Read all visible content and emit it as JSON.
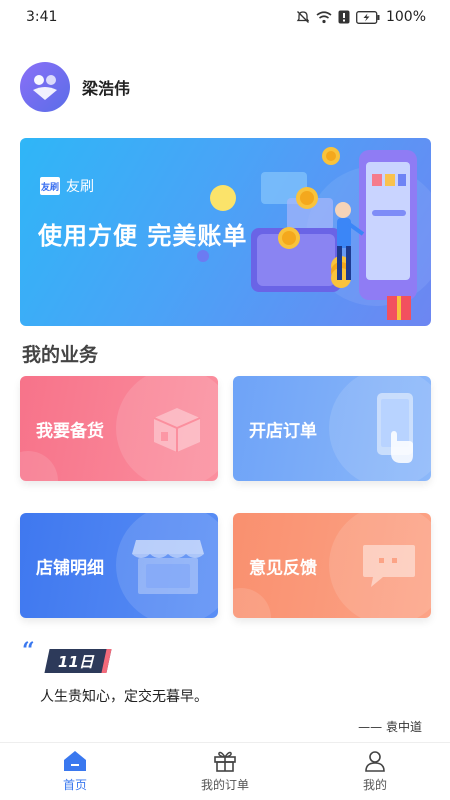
{
  "status_bar": {
    "time": "3:41",
    "battery_percent": "100%",
    "icons": [
      "mute-icon",
      "wifi-icon",
      "alert-icon",
      "battery-icon"
    ]
  },
  "profile": {
    "avatar_icon": "user-group-avatar-icon",
    "name": "梁浩伟"
  },
  "banner": {
    "brand_logo_text": "友刷",
    "brand_name": "友刷",
    "slogan": "使用方便 完美账单",
    "accent_color": "#3a9cf5"
  },
  "section": {
    "title": "我的业务"
  },
  "cards": [
    {
      "label": "我要备货",
      "icon": "box-icon",
      "color": "#f7738a"
    },
    {
      "label": "开店订单",
      "icon": "phone-tap-icon",
      "color": "#6ea3f7"
    },
    {
      "label": "店铺明细",
      "icon": "storefront-icon",
      "color": "#3f78ef"
    },
    {
      "label": "意见反馈",
      "icon": "chat-bubble-icon",
      "color": "#f9906f"
    }
  ],
  "quote": {
    "date": "11日",
    "text": "人生贵知心，定交无暮早。",
    "author": "—— 袁中道"
  },
  "tabs": [
    {
      "label": "首页",
      "icon": "home-icon",
      "active": true
    },
    {
      "label": "我的订单",
      "icon": "gift-icon",
      "active": false
    },
    {
      "label": "我的",
      "icon": "person-icon",
      "active": false
    }
  ],
  "colors": {
    "primary": "#3a78ef",
    "text": "#222222"
  }
}
